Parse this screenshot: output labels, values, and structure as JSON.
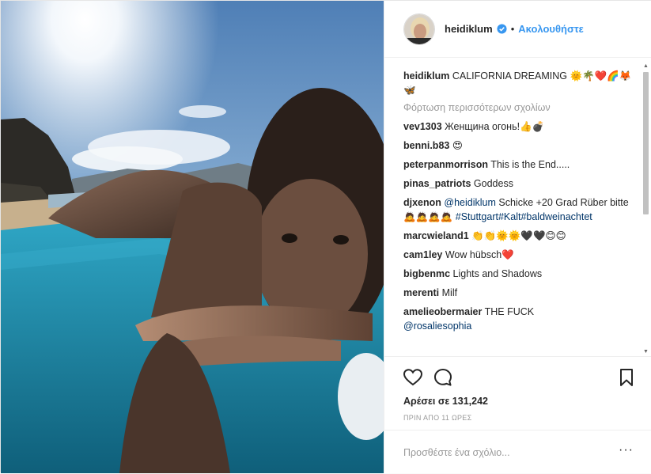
{
  "post": {
    "username": "heidiklum",
    "verified_icon": "verified-badge-icon",
    "separator": "•",
    "follow_label": "Ακολουθήστε",
    "accent_color": "#3897f0",
    "photo_subject": "beach selfie"
  },
  "caption": {
    "user": "heidiklum",
    "text": "CALIFORNIA DREAMING 🌞🌴❤️🌈🦊🦋"
  },
  "load_more_label": "Φόρτωση περισσότερων σχολίων",
  "comments": [
    {
      "user": "vev1303",
      "text": "Женщина огонь!👍💣"
    },
    {
      "user": "benni.b83",
      "text": "😍"
    },
    {
      "user": "peterpanmorrison",
      "text": "This is the End....."
    },
    {
      "user": "pinas_patriots",
      "text": "Goddess"
    },
    {
      "user": "djxenon",
      "mention": "@heidiklum",
      "text": "Schicke +20 Grad Rüber bitte 🙇🙇🙇🙇",
      "hashtags": "#Stuttgart#Kalt#baldweinachtet"
    },
    {
      "user": "marcwieland1",
      "text": "👏👏🌞🌞🖤🖤😊😊"
    },
    {
      "user": "cam1ley",
      "text": "Wow hübsch❤️"
    },
    {
      "user": "bigbenmc",
      "text": "Lights and Shadows"
    },
    {
      "user": "merenti",
      "text": "Milf"
    },
    {
      "user": "amelieobermaier",
      "text": "THE FUCK",
      "mention": "@rosaliesophia"
    }
  ],
  "actions": {
    "like_icon": "heart-icon",
    "comment_icon": "comment-bubble-icon",
    "save_icon": "bookmark-icon",
    "likes_label": "Αρέσει σε 131,242",
    "timestamp": "ΠΡΙΝ ΑΠΟ 11 ΩΡΕΣ",
    "comment_placeholder": "Προσθέστε ένα σχόλιο...",
    "more_label": "···"
  }
}
